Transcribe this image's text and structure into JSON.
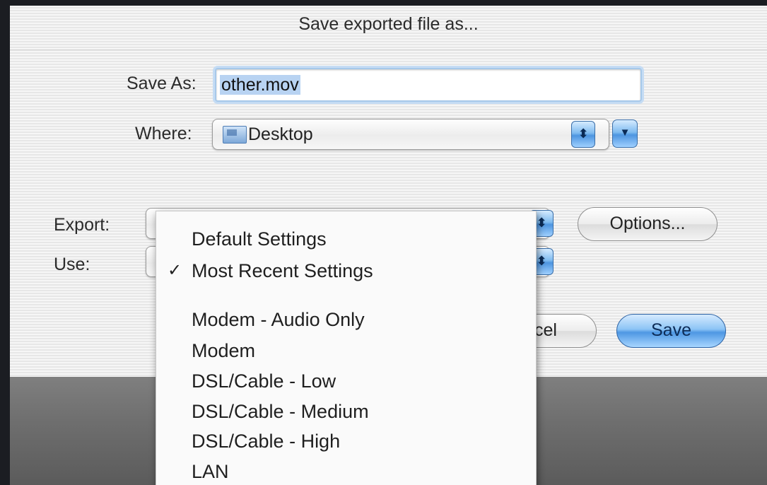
{
  "dialog": {
    "title": "Save exported file as..."
  },
  "save_as": {
    "label": "Save As:",
    "filename_selected": "other.mov"
  },
  "where": {
    "label": "Where:",
    "value": "Desktop",
    "folder_icon": "desktop-folder-icon"
  },
  "export": {
    "label": "Export:"
  },
  "use": {
    "label": "Use:"
  },
  "buttons": {
    "options": "Options...",
    "cancel": "Cancel",
    "save": "Save"
  },
  "menu": {
    "check_glyph": "✓",
    "items": [
      {
        "label": "Default Settings",
        "checked": false
      },
      {
        "label": "Most Recent Settings",
        "checked": true
      },
      {
        "label": "Modem - Audio Only",
        "checked": false
      },
      {
        "label": "Modem",
        "checked": false
      },
      {
        "label": "DSL/Cable - Low",
        "checked": false
      },
      {
        "label": "DSL/Cable - Medium",
        "checked": false
      },
      {
        "label": "DSL/Cable - High",
        "checked": false
      },
      {
        "label": "LAN",
        "checked": false
      }
    ]
  },
  "colors": {
    "accent": "#4e97e3",
    "focus_ring": "#a7c9ea",
    "selection": "#b8d3f2"
  }
}
